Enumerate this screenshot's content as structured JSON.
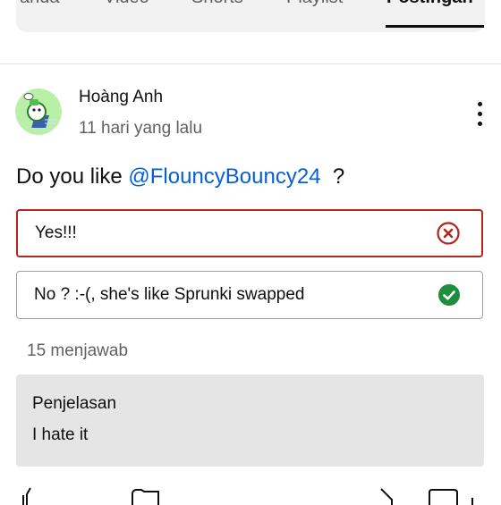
{
  "tabs": [
    {
      "label": "anda"
    },
    {
      "label": "Video"
    },
    {
      "label": "Shorts"
    },
    {
      "label": "Playlist"
    },
    {
      "label": "Postingan",
      "active": true
    }
  ],
  "post": {
    "author": "Hoàng Anh",
    "time": "11 hari yang lalu",
    "question_prefix": "Do you like ",
    "mention": "@FlouncyBouncy24",
    "question_suffix": "  ?",
    "options": [
      {
        "label": "Yes!!!",
        "state": "wrong",
        "icon": "x-circle-icon"
      },
      {
        "label": "No ? :-(, she's like Sprunki swapped",
        "state": "correct",
        "icon": "check-circle-icon"
      }
    ],
    "votes": "15 menjawab",
    "explanation": {
      "title": "Penjelasan",
      "text": "I hate it"
    }
  },
  "colors": {
    "mention": "#065fd4",
    "wrong": "#b3261e",
    "correct": "#1e8e3e",
    "explanation_bg": "#e5e5e5"
  }
}
